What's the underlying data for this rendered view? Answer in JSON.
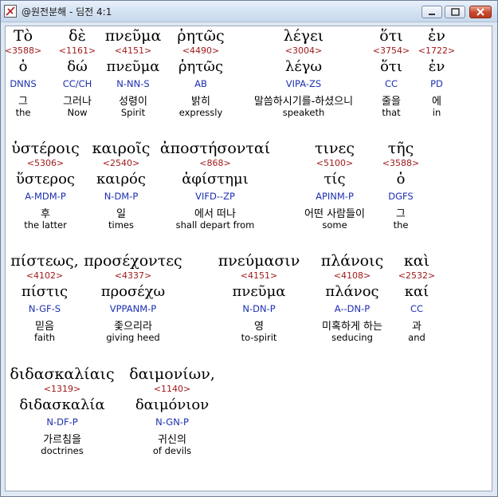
{
  "window": {
    "title": "@원전분해 - 딤전 4:1"
  },
  "words": [
    {
      "greek": "Τὸ",
      "strong": "<3588>",
      "lemma": "ὁ",
      "parse": "DNNS",
      "kor": "그",
      "eng": "the"
    },
    {
      "greek": "δὲ",
      "strong": "<1161>",
      "lemma": "δώ",
      "parse": "CC/CH",
      "kor": "그러나",
      "eng": "Now"
    },
    {
      "greek": "πνεῦμα",
      "strong": "<4151>",
      "lemma": "πνεῦμα",
      "parse": "N-NN-S",
      "kor": "성령이",
      "eng": "Spirit"
    },
    {
      "greek": "ῥητῶς",
      "strong": "<4490>",
      "lemma": "ῥητῶς",
      "parse": "AB",
      "kor": "밝히",
      "eng": "expressly"
    },
    {
      "greek": "λέγει",
      "strong": "<3004>",
      "lemma": "λέγω",
      "parse": "VIPA-ZS",
      "kor": "말씀하시기를-하셨으니",
      "eng": "speaketh"
    },
    {
      "greek": "ὅτι",
      "strong": "<3754>",
      "lemma": "ὅτι",
      "parse": "CC",
      "kor": "줄을",
      "eng": "that"
    },
    {
      "greek": "ἐν",
      "strong": "<1722>",
      "lemma": "ἐν",
      "parse": "PD",
      "kor": "에",
      "eng": "in"
    },
    {
      "greek": "ὑστέροις",
      "strong": "<5306>",
      "lemma": "ὕστερος",
      "parse": "A-MDM-P",
      "kor": "후",
      "eng": "the latter"
    },
    {
      "greek": "καιροῖς",
      "strong": "<2540>",
      "lemma": "καιρός",
      "parse": "N-DM-P",
      "kor": "일",
      "eng": "times"
    },
    {
      "greek": "ἀποστήσονταί",
      "strong": "<868>",
      "lemma": "ἀφίστημι",
      "parse": "VIFD--ZP",
      "kor": "에서 떠나",
      "eng": "shall depart from"
    },
    {
      "greek": "τινες",
      "strong": "<5100>",
      "lemma": "τίς",
      "parse": "APINM-P",
      "kor": "어떤 사람들이",
      "eng": "some"
    },
    {
      "greek": "τῆς",
      "strong": "<3588>",
      "lemma": "ὁ",
      "parse": "DGFS",
      "kor": "그",
      "eng": "the"
    },
    {
      "greek": "πίστεως,",
      "strong": "<4102>",
      "lemma": "πίστις",
      "parse": "N-GF-S",
      "kor": "믿음",
      "eng": "faith"
    },
    {
      "greek": "προσέχοντες",
      "strong": "<4337>",
      "lemma": "προσέχω",
      "parse": "VPPANM-P",
      "kor": "좇으리라",
      "eng": "giving heed"
    },
    {
      "greek": "πνεύμασιν",
      "strong": "<4151>",
      "lemma": "πνεῦμα",
      "parse": "N-DN-P",
      "kor": "영",
      "eng": "to-spirit"
    },
    {
      "greek": "πλάνοις",
      "strong": "<4108>",
      "lemma": "πλάνος",
      "parse": "A--DN-P",
      "kor": "미혹하게 하는",
      "eng": "seducing"
    },
    {
      "greek": "καὶ",
      "strong": "<2532>",
      "lemma": "καί",
      "parse": "CC",
      "kor": "과",
      "eng": "and"
    },
    {
      "greek": "διδασκαλίαις",
      "strong": "<1319>",
      "lemma": "διδασκαλία",
      "parse": "N-DF-P",
      "kor": "가르침을",
      "eng": "doctrines"
    },
    {
      "greek": "δαιμονίων,",
      "strong": "<1140>",
      "lemma": "δαιμόνιον",
      "parse": "N-GN-P",
      "kor": "귀신의",
      "eng": "of devils"
    }
  ]
}
